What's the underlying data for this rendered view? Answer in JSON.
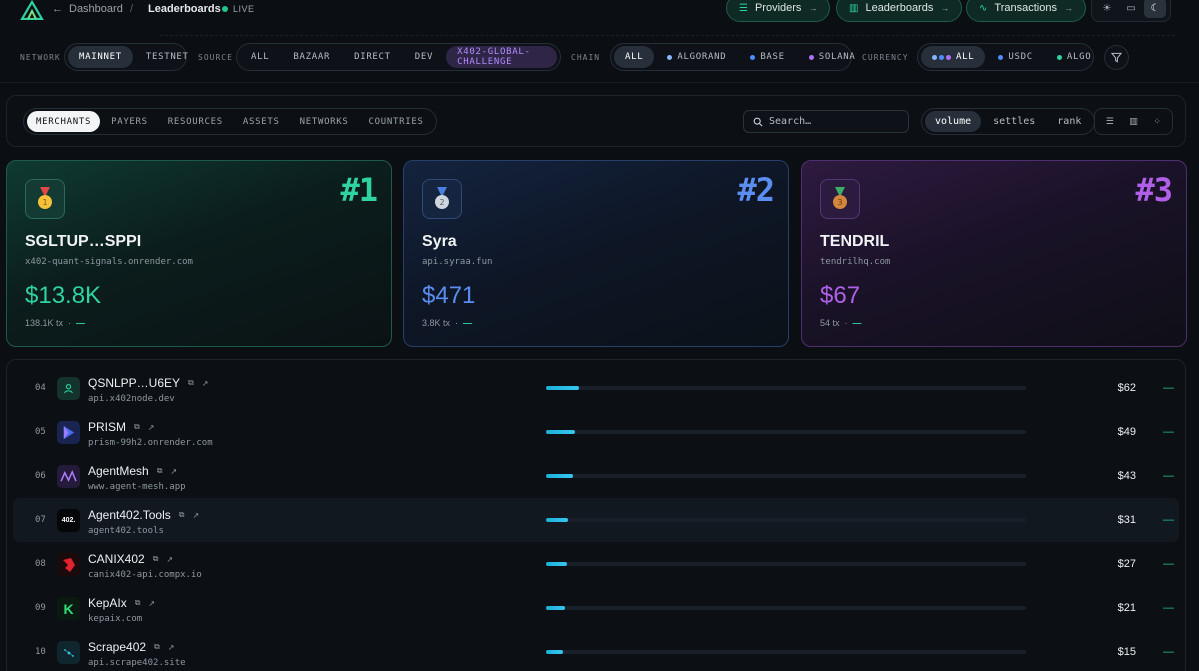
{
  "header": {
    "back_label": "Dashboard",
    "separator": "/",
    "current": "Leaderboards",
    "live_label": "LIVE",
    "nav": [
      {
        "label": "Providers",
        "icon": "list-icon"
      },
      {
        "label": "Leaderboards",
        "icon": "bar-chart-icon"
      },
      {
        "label": "Transactions",
        "icon": "activity-icon"
      }
    ],
    "theme_toggle": [
      "sun-icon",
      "monitor-icon",
      "moon-icon"
    ]
  },
  "filters": {
    "network_label": "NETWORK",
    "network": [
      "MAINNET",
      "TESTNET"
    ],
    "source_label": "SOURCE",
    "source": [
      "ALL",
      "BAZAAR",
      "DIRECT",
      "DEV",
      "X402-GLOBAL-CHALLENGE"
    ],
    "chain_label": "CHAIN",
    "chain": [
      "ALL",
      "ALGORAND",
      "BASE",
      "SOLANA"
    ],
    "currency_label": "CURRENCY",
    "currency": [
      "ALL",
      "USDC",
      "ALGO"
    ]
  },
  "tabs": [
    "MERCHANTS",
    "PAYERS",
    "RESOURCES",
    "ASSETS",
    "NETWORKS",
    "COUNTRIES"
  ],
  "search": {
    "placeholder": "Search…"
  },
  "sort": [
    "volume",
    "settles",
    "rank"
  ],
  "colors": {
    "gold": "#2ed3a0",
    "silver": "#5b8ef0",
    "bronze": "#b060e8",
    "accent": "#22c58a"
  },
  "podium": [
    {
      "rank": "#1",
      "name": "SGLTUP…SPPI",
      "domain": "x402-quant-signals.onrender.com",
      "value": "$13.8K",
      "tx": "138.1K tx",
      "sep": "·",
      "change": "—"
    },
    {
      "rank": "#2",
      "name": "Syra",
      "domain": "api.syraa.fun",
      "value": "$471",
      "tx": "3.8K tx",
      "sep": "·",
      "change": "—"
    },
    {
      "rank": "#3",
      "name": "TENDRIL",
      "domain": "tendrilhq.com",
      "value": "$67",
      "tx": "54 tx",
      "sep": "·",
      "change": "—"
    }
  ],
  "rows": [
    {
      "num": "04",
      "name": "QSNLPP…U6EY",
      "domain": "api.x402node.dev",
      "value": "$62",
      "share": 0.068,
      "change": "—"
    },
    {
      "num": "05",
      "name": "PRISM",
      "domain": "prism-99h2.onrender.com",
      "value": "$49",
      "share": 0.06,
      "change": "—"
    },
    {
      "num": "06",
      "name": "AgentMesh",
      "domain": "www.agent-mesh.app",
      "value": "$43",
      "share": 0.056,
      "change": "—"
    },
    {
      "num": "07",
      "name": "Agent402.Tools",
      "domain": "agent402.tools",
      "value": "$31",
      "share": 0.046,
      "change": "—",
      "avatar_text": "402."
    },
    {
      "num": "08",
      "name": "CANIX402",
      "domain": "canix402-api.compx.io",
      "value": "$27",
      "share": 0.044,
      "change": "—"
    },
    {
      "num": "09",
      "name": "KepAIx",
      "domain": "kepaix.com",
      "value": "$21",
      "share": 0.039,
      "change": "—",
      "avatar_text": "K"
    },
    {
      "num": "10",
      "name": "Scrape402",
      "domain": "api.scrape402.site",
      "value": "$15",
      "share": 0.036,
      "change": "—"
    }
  ]
}
